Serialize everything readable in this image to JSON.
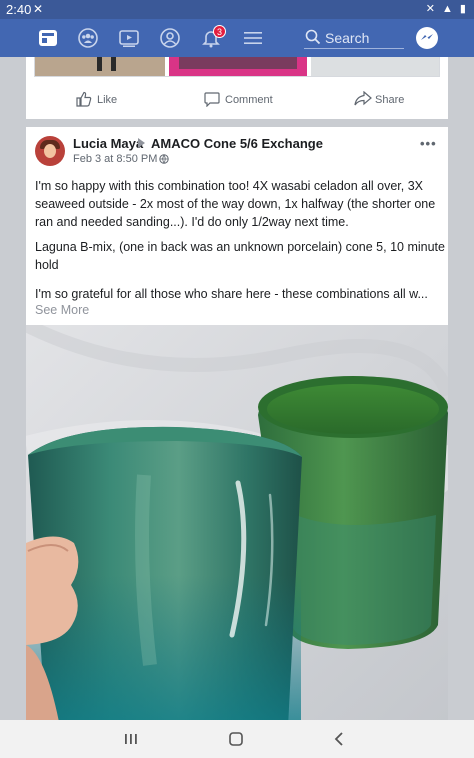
{
  "status_bar": {
    "time": "2:40"
  },
  "nav": {
    "notifications_badge": "3",
    "search_placeholder": "Search"
  },
  "previous_post": {
    "like": "Like",
    "comment": "Comment",
    "share": "Share"
  },
  "post": {
    "author": "Lucia Maya",
    "group": "AMACO Cone 5/6 Exchange",
    "timestamp": "Feb 3 at 8:50 PM",
    "separator": "·",
    "paragraph_1": "I'm so happy with this combination too! 4X wasabi celadon all over, 3X seaweed outside - 2x most of the way down, 1x halfway (the shorter one ran and needed sanding...). I'd do only 1/2way next time.",
    "paragraph_2": "Laguna B-mix, (one in back was an unknown porcelain) cone 5, 10 minute hold",
    "paragraph_3": "I'm so grateful for all those who share here - these combinations all w...",
    "see_more": "See More"
  },
  "colors": {
    "facebook_blue": "#4267b2",
    "status_bar": "#3b5998",
    "badge_red": "#e41e3f",
    "mug_front_green": "#2f7a62",
    "mug_back_green": "#3f8a3c"
  }
}
